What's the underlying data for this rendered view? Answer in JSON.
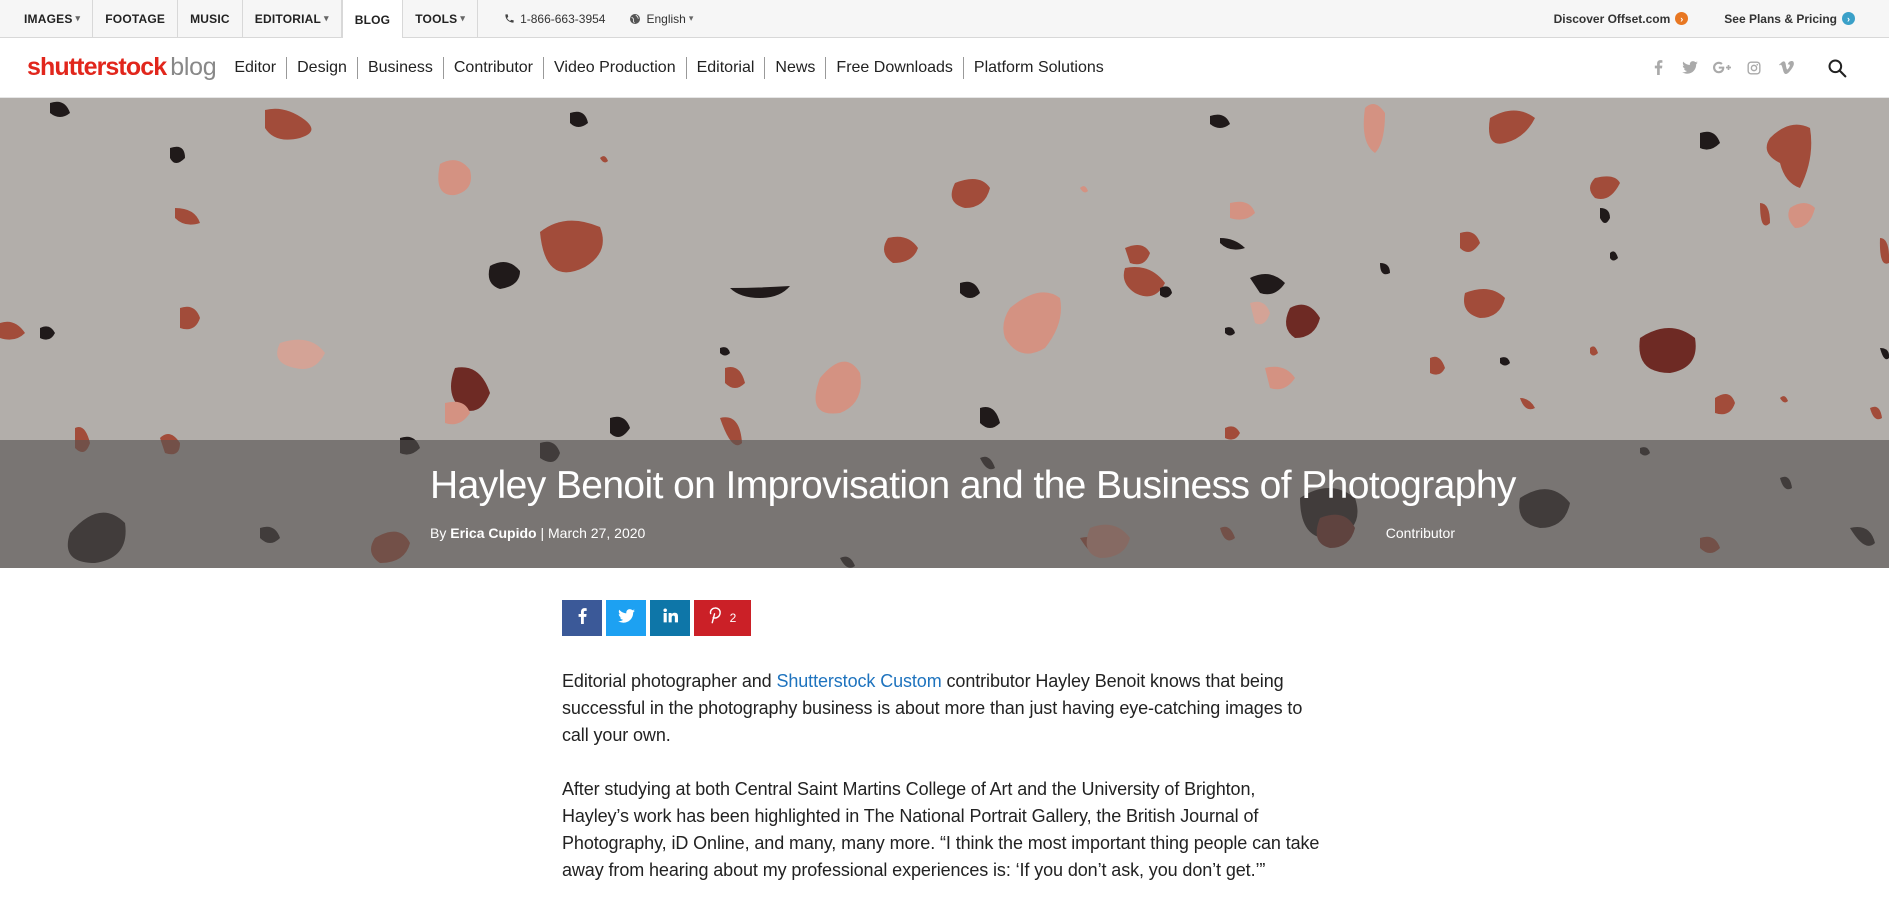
{
  "topbar": {
    "nav": [
      {
        "label": "IMAGES",
        "caret": "▾"
      },
      {
        "label": "FOOTAGE",
        "caret": ""
      },
      {
        "label": "MUSIC",
        "caret": ""
      },
      {
        "label": "EDITORIAL",
        "caret": "▾"
      },
      {
        "label": "BLOG",
        "caret": ""
      },
      {
        "label": "TOOLS",
        "caret": "▾"
      }
    ],
    "phone": "1-866-663-3954",
    "language": "English",
    "language_caret": "▾",
    "discover": "Discover Offset.com",
    "plans": "See Plans & Pricing"
  },
  "logo": {
    "main": "shutterstock",
    "suffix": "blog"
  },
  "categories": [
    "Editor",
    "Design",
    "Business",
    "Contributor",
    "Video Production",
    "Editorial",
    "News",
    "Free Downloads",
    "Platform Solutions"
  ],
  "social_icons": [
    "facebook-icon",
    "twitter-icon",
    "google-plus-icon",
    "instagram-icon",
    "vimeo-icon"
  ],
  "hero": {
    "title": "Hayley Benoit on Improvisation and the Business of Photography",
    "by": "By",
    "author": "Erica Cupido",
    "separator": "|",
    "date": "March 27, 2020",
    "category": "Contributor"
  },
  "share": {
    "pinterest_count": "2"
  },
  "article": {
    "p1_before": "Editorial photographer and ",
    "p1_link": "Shutterstock Custom",
    "p1_after": " contributor Hayley Benoit knows that being successful in the photography business is about more than just having eye-catching images to call your own.",
    "p2": "After studying at both Central Saint Martins College of Art and the University of Brighton, Hayley’s work has been highlighted in The National Portrait Gallery, the British Journal of Photography, iD Online, and many, many more. “I think the most important thing people can take away from hearing about my professional experiences is: ‘If you don’t ask, you don’t get.’”"
  },
  "colors": {
    "brand_red": "#e1261c",
    "link_blue": "#1e73be",
    "offset_orange": "#e87722",
    "plans_blue": "#3aa0c8",
    "facebook": "#3b5998",
    "twitter": "#1da1f2",
    "linkedin": "#0e76a8",
    "pinterest": "#cb2027"
  }
}
